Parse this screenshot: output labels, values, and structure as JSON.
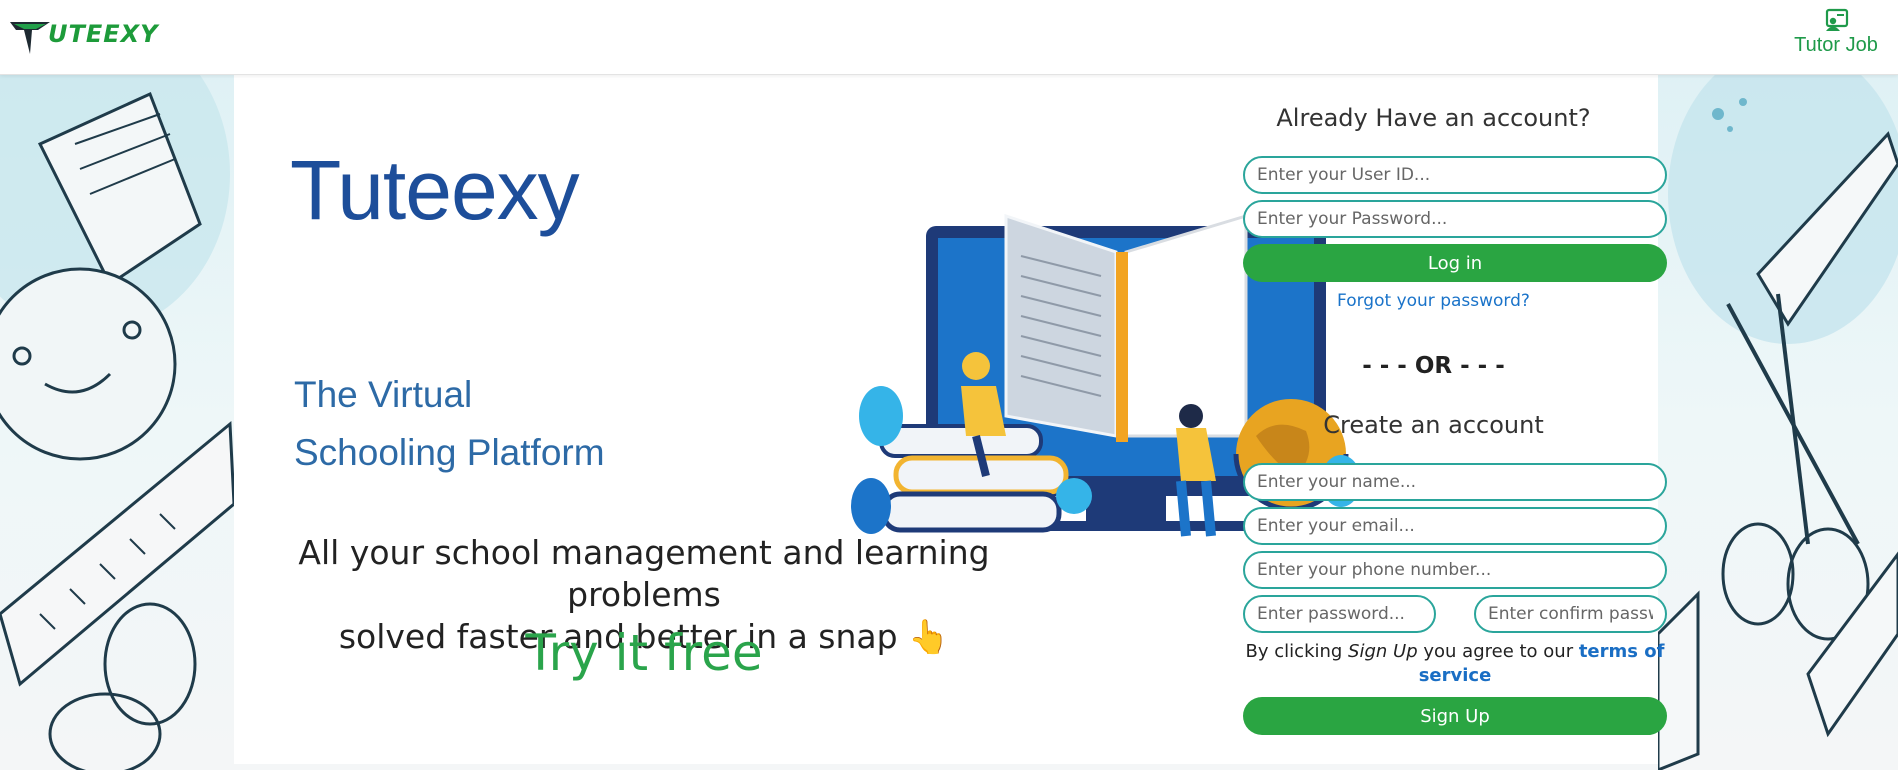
{
  "header": {
    "logo_text": "UTEEXY",
    "tutor_job_label": "Tutor Job",
    "tutor_job_icon": "user-board-icon",
    "accent_color": "#1f9a4a"
  },
  "hero": {
    "brand_title": "Tuteexy",
    "tagline_line1": "The Virtual",
    "tagline_line2": "Schooling Platform",
    "promo_line1": "All your school management and learning problems",
    "promo_line2": "solved faster and better in a snap 👆",
    "try_free": "Try it free"
  },
  "login": {
    "heading": "Already Have an account?",
    "user_id_placeholder": "Enter your User ID...",
    "password_placeholder": "Enter your Password...",
    "login_button": "Log in",
    "forgot_link": "Forgot your password?"
  },
  "divider": {
    "or_text": "- - - OR - - -"
  },
  "signup": {
    "heading": "Create an account",
    "name_placeholder": "Enter your name...",
    "email_placeholder": "Enter your email...",
    "phone_placeholder": "Enter your phone number...",
    "password_placeholder": "Enter password...",
    "confirm_placeholder": "Enter confirm password...",
    "terms_prefix": "By clicking ",
    "terms_action": "Sign Up",
    "terms_middle": " you agree to our ",
    "terms_link": "terms of service",
    "signup_button": "Sign Up"
  },
  "colors": {
    "brand_blue": "#1d4e9a",
    "button_green": "#2aa542",
    "field_border": "#2aa59b",
    "link_blue": "#1a73c9"
  }
}
